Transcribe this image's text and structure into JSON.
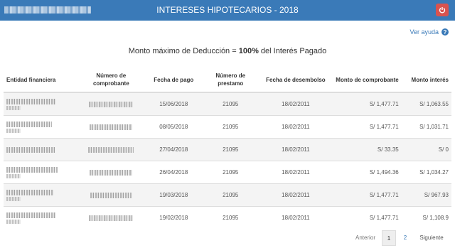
{
  "header": {
    "title": "INTERESES HIPOTECARIOS - 2018",
    "close_icon": "power-icon"
  },
  "help": {
    "label": "Ver ayuda",
    "icon": "question-circle-icon"
  },
  "summary": {
    "prefix": "Monto máximo de Deducción = ",
    "pct": "100%",
    "suffix": " del Interés Pagado"
  },
  "table": {
    "headers": [
      "Entidad financiera",
      "Número de comprobante",
      "Fecha de pago",
      "Número de prestamo",
      "Fecha de desembolso",
      "Monto de comprobante",
      "Monto interés"
    ],
    "rows": [
      {
        "fecha_pago": "15/06/2018",
        "prestamo": "21095",
        "desembolso": "18/02/2011",
        "monto": "S/ 1,477.71",
        "interes": "S/ 1,063.55"
      },
      {
        "fecha_pago": "08/05/2018",
        "prestamo": "21095",
        "desembolso": "18/02/2011",
        "monto": "S/ 1,477.71",
        "interes": "S/ 1,031.71"
      },
      {
        "fecha_pago": "27/04/2018",
        "prestamo": "21095",
        "desembolso": "18/02/2011",
        "monto": "S/ 33.35",
        "interes": "S/ 0"
      },
      {
        "fecha_pago": "26/04/2018",
        "prestamo": "21095",
        "desembolso": "18/02/2011",
        "monto": "S/ 1,494.36",
        "interes": "S/ 1,034.27"
      },
      {
        "fecha_pago": "19/03/2018",
        "prestamo": "21095",
        "desembolso": "18/02/2011",
        "monto": "S/ 1,477.71",
        "interes": "S/ 967.93"
      },
      {
        "fecha_pago": "19/02/2018",
        "prestamo": "21095",
        "desembolso": "18/02/2011",
        "monto": "S/ 1,477.71",
        "interes": "S/ 1,108.9"
      }
    ]
  },
  "pager": {
    "prev": "Anterior",
    "pages": [
      "1",
      "2"
    ],
    "next": "Siguiente",
    "current": "1"
  }
}
